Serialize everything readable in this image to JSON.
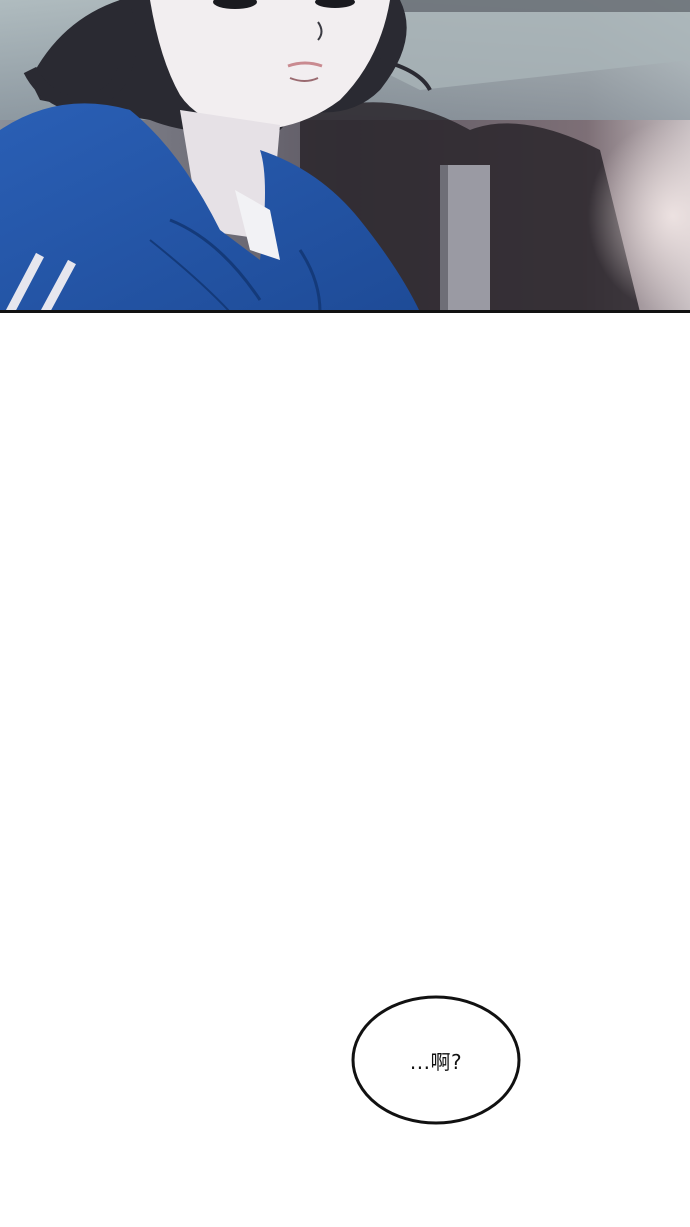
{
  "panel": {
    "illustration": "girl-in-blue-tracksuit-scene",
    "colors": {
      "jacket_blue": "#2d63b8",
      "background_grey": "#6f6a73",
      "hair_dark": "#2a2a32",
      "skin": "#f2eef0"
    }
  },
  "speech_bubble": {
    "text": "...啊?"
  }
}
